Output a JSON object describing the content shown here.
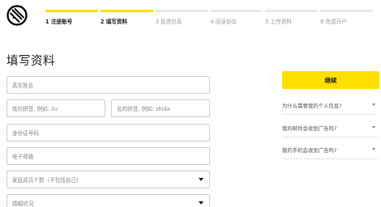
{
  "brand": {
    "logo_icon": "zebra-stripe-logo-icon",
    "accent": "#ffe000"
  },
  "steps": [
    {
      "label": "1 注册账号",
      "done": true,
      "active": true
    },
    {
      "label": "2 填写资料",
      "done": true,
      "active": true
    },
    {
      "label": "3 投资信息",
      "done": false,
      "active": false
    },
    {
      "label": "4 阅读协议",
      "done": false,
      "active": false
    },
    {
      "label": "5 上传资料",
      "done": false,
      "active": false
    },
    {
      "label": "6 完成开户",
      "done": false,
      "active": false
    }
  ],
  "page_title": "填写资料",
  "form": {
    "real_name_placeholder": "真实姓名",
    "surname_pinyin_placeholder": "姓的拼音, 例如: liu",
    "given_name_pinyin_placeholder": "名的拼音, 例如: zhida",
    "id_number_placeholder": "身份证号码",
    "email_placeholder": "电子邮箱",
    "family_size_placeholder": "家庭成员个数（不包括自己）",
    "marital_status_placeholder": "婚姻状况"
  },
  "sidebar": {
    "continue_label": "继续",
    "faq": [
      {
        "question": "为什么需要我的个人信息?"
      },
      {
        "question": "我的邮件会收到广告吗?"
      },
      {
        "question": "我的手机会收到广告吗?"
      }
    ]
  }
}
